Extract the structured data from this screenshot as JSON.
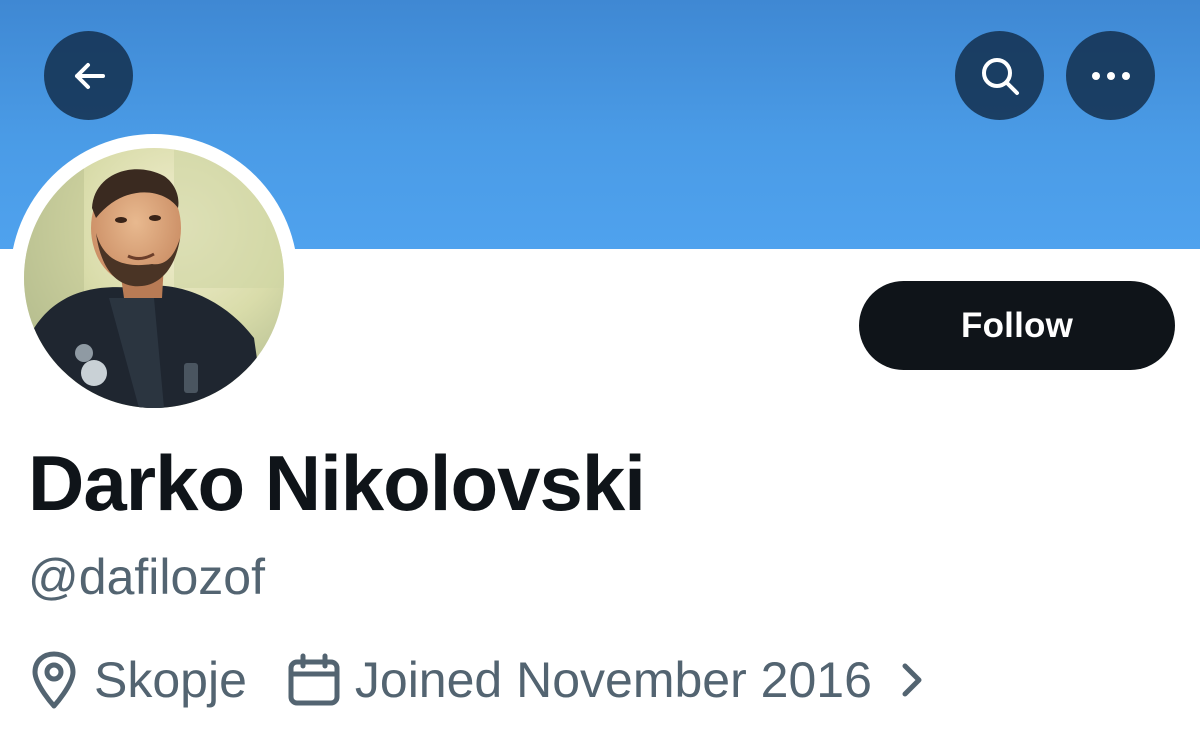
{
  "header": {
    "back_icon": "arrow-left-icon",
    "search_icon": "search-icon",
    "more_icon": "more-horizontal-icon",
    "banner_color": "#4a9be6"
  },
  "profile": {
    "display_name": "Darko Nikolovski",
    "handle": "@dafilozof",
    "location": "Skopje",
    "joined": "Joined November 2016",
    "follow_label": "Follow"
  },
  "colors": {
    "follow_button_bg": "#0f1419",
    "secondary_text": "#536471"
  }
}
